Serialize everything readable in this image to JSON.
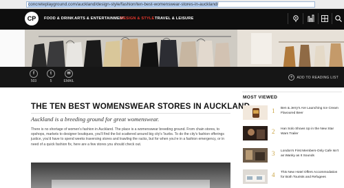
{
  "browser": {
    "url_host": "concreteplayground.com",
    "url_path": "/auckland/design-style/fashion/ten-best-womenswear-stores-in-auckland/"
  },
  "nav": {
    "logo": "CP",
    "items": [
      {
        "label": "FOOD & DRINK",
        "active": false
      },
      {
        "label": "ARTS & ENTERTAINMENT",
        "active": false
      },
      {
        "label": "DESIGN & STYLE",
        "active": true
      },
      {
        "label": "TRAVEL & LEISURE",
        "active": false
      }
    ],
    "icons": [
      "location-pin-icon",
      "city-skyline-icon",
      "grid-icon",
      "search-icon"
    ]
  },
  "share": {
    "items": [
      {
        "icon": "facebook-icon",
        "glyph": "f",
        "count": "503"
      },
      {
        "icon": "twitter-icon",
        "glyph": "t",
        "count": "5"
      },
      {
        "icon": "email-icon",
        "glyph": "✉",
        "count": "EMAIL"
      }
    ],
    "reading_list": "ADD TO READING LIST"
  },
  "article": {
    "title": "THE TEN BEST WOMENSWEAR STORES IN AUCKLAND",
    "subtitle": "Auckland is a breeding ground for great womenswear.",
    "body": "There is no shortage of women's fashion in Auckland. The place is a womenswear breeding ground. From chain stores, to opshops, markets to designer boutiques, you'll find the list scattered around big city's 'burbs. To do the city's fashion offerings justice, you'd have to spend weeks traversing stores and trawling the racks, but for when you're in a fashion emergency, or in need of a quick fashion fix, here are a few stores you should check out."
  },
  "most_viewed": {
    "title": "MOST VIEWED",
    "items": [
      {
        "num": "1",
        "text": "Ben & Jerry's Are Launching Ice Cream Flavoured Beer"
      },
      {
        "num": "2",
        "text": "Han Solo Shows Up in the New Star Wars Trailer"
      },
      {
        "num": "3",
        "text": "London's First Members-Only Cafe Isn't as Wanky as It Sounds"
      },
      {
        "num": "4",
        "text": "This New Hotel Offers Accommodation for Both Tourists and Refugees"
      }
    ]
  },
  "colors": {
    "nav_bg": "#0e0e0e",
    "accent_active": "#e8382d",
    "number_gold": "#c9a23f"
  }
}
